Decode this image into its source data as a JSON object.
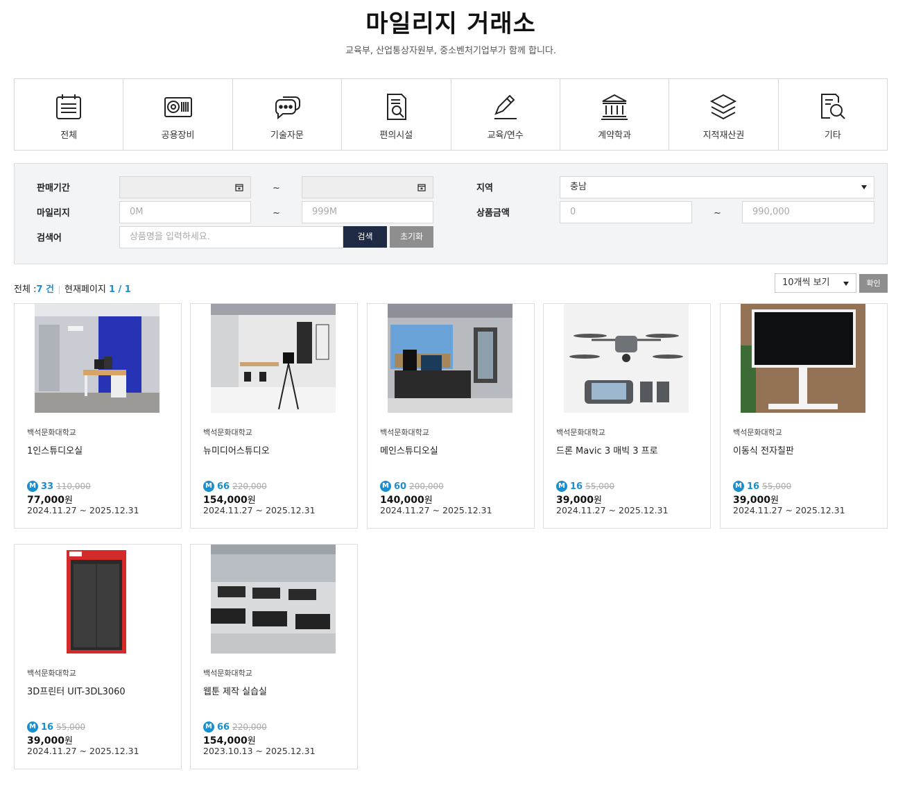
{
  "page": {
    "title": "마일리지 거래소",
    "subtitle": "교육부, 산업통상자원부, 중소벤처기업부가 함께 합니다."
  },
  "categories": [
    {
      "label": "전체",
      "icon": "calendar-list-icon"
    },
    {
      "label": "공용장비",
      "icon": "equipment-icon"
    },
    {
      "label": "기술자문",
      "icon": "chat-bubbles-icon"
    },
    {
      "label": "편의시설",
      "icon": "document-search-icon"
    },
    {
      "label": "교육/연수",
      "icon": "pencil-icon"
    },
    {
      "label": "계약학과",
      "icon": "institution-icon"
    },
    {
      "label": "지적재산권",
      "icon": "layers-icon"
    },
    {
      "label": "기타",
      "icon": "document-magnifier-icon"
    }
  ],
  "filters": {
    "sale_period_label": "판매기간",
    "mileage_label": "마일리지",
    "keyword_label": "검색어",
    "region_label": "지역",
    "price_label": "상품금액",
    "tilde": "~",
    "mileage_min_placeholder": "0M",
    "mileage_max_placeholder": "999M",
    "keyword_placeholder": "상품명을 입력하세요.",
    "region_value": "충남",
    "price_min_placeholder": "0",
    "price_max_placeholder": "990,000",
    "search_button": "검색",
    "reset_button": "초기화"
  },
  "summary": {
    "total_label": "전체 :",
    "total_count": "7 건",
    "current_page_label": "현재페이지",
    "current_page": "1 / 1",
    "per_page": "10개씩 보기",
    "confirm_button": "확인"
  },
  "badge_letter": "M",
  "won_unit": "원",
  "products": [
    {
      "school": "백석문화대학교",
      "name": "1인스튜디오실",
      "mileage": "33",
      "original_price": "110,000",
      "price": "77,000",
      "period": "2024.11.27 ~ 2025.12.31"
    },
    {
      "school": "백석문화대학교",
      "name": "뉴미디어스튜디오",
      "mileage": "66",
      "original_price": "220,000",
      "price": "154,000",
      "period": "2024.11.27 ~ 2025.12.31"
    },
    {
      "school": "백석문화대학교",
      "name": "메인스튜디오실",
      "mileage": "60",
      "original_price": "200,000",
      "price": "140,000",
      "period": "2024.11.27 ~ 2025.12.31"
    },
    {
      "school": "백석문화대학교",
      "name": "드론 Mavic 3 매빅 3 프로",
      "mileage": "16",
      "original_price": "55,000",
      "price": "39,000",
      "period": "2024.11.27 ~ 2025.12.31"
    },
    {
      "school": "백석문화대학교",
      "name": "이동식 전자칠판",
      "mileage": "16",
      "original_price": "55,000",
      "price": "39,000",
      "period": "2024.11.27 ~ 2025.12.31"
    },
    {
      "school": "백석문화대학교",
      "name": "3D프린터 UIT-3DL3060",
      "mileage": "16",
      "original_price": "55,000",
      "price": "39,000",
      "period": "2024.11.27 ~ 2025.12.31"
    },
    {
      "school": "백석문화대학교",
      "name": "웹툰 제작 실습실",
      "mileage": "66",
      "original_price": "220,000",
      "price": "154,000",
      "period": "2023.10.13 ~ 2025.12.31"
    }
  ]
}
